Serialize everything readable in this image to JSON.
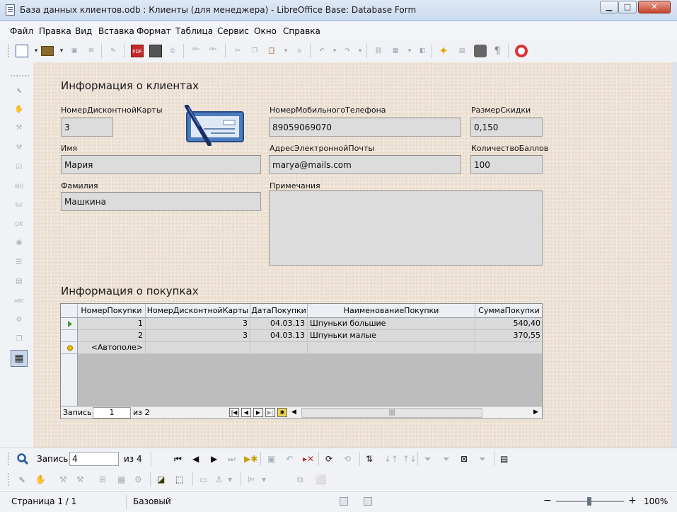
{
  "window": {
    "title": "База данных клиентов.odb : Клиенты (для менеджера) - LibreOffice Base: Database Form",
    "minimize": "▁",
    "maximize": "□",
    "close": "✕"
  },
  "menu": [
    "Файл",
    "Правка",
    "Вид",
    "Вставка",
    "Формат",
    "Таблица",
    "Сервис",
    "Окно",
    "Справка"
  ],
  "form": {
    "section_client": "Информация о клиентах",
    "section_purchases": "Информация о покупках",
    "fields": {
      "card_number": {
        "label": "НомерДисконтнойКарты",
        "value": "3"
      },
      "mobile": {
        "label": "НомерМобильногоТелефона",
        "value": "89059069070"
      },
      "discount": {
        "label": "РазмерСкидки",
        "value": "0,150"
      },
      "first_name": {
        "label": "Имя",
        "value": "Мария"
      },
      "email": {
        "label": "АдресЭлектроннойПочты",
        "value": "marya@mails.com"
      },
      "points": {
        "label": "КоличествоБаллов",
        "value": "100"
      },
      "last_name": {
        "label": "Фамилия",
        "value": "Машкина"
      },
      "notes": {
        "label": "Примечания",
        "value": ""
      }
    }
  },
  "grid": {
    "columns": [
      "НомерПокупки",
      "НомерДисконтнойКарты",
      "ДатаПокупки",
      "НаименованиеПокупки",
      "СуммаПокупки"
    ],
    "rows": [
      [
        "1",
        "3",
        "04.03.13",
        "Шпуньки большие",
        "540,40"
      ],
      [
        "2",
        "3",
        "04.03.13",
        "Шпуньки малые",
        "370,55"
      ]
    ],
    "new_row_placeholder": "<Автополе>",
    "nav": {
      "record_label": "Запись",
      "record_value": "1",
      "of_text": "из 2"
    }
  },
  "navbar": {
    "record_label": "Запись",
    "record_value": "4",
    "of_text": "из 4"
  },
  "status": {
    "page": "Страница 1 / 1",
    "style": "Базовый",
    "zoom": "100%"
  },
  "colors": {
    "form_bg": "#efe4d8",
    "field_bg": "#dcdcdc",
    "chrome": "#f0f2f6"
  }
}
